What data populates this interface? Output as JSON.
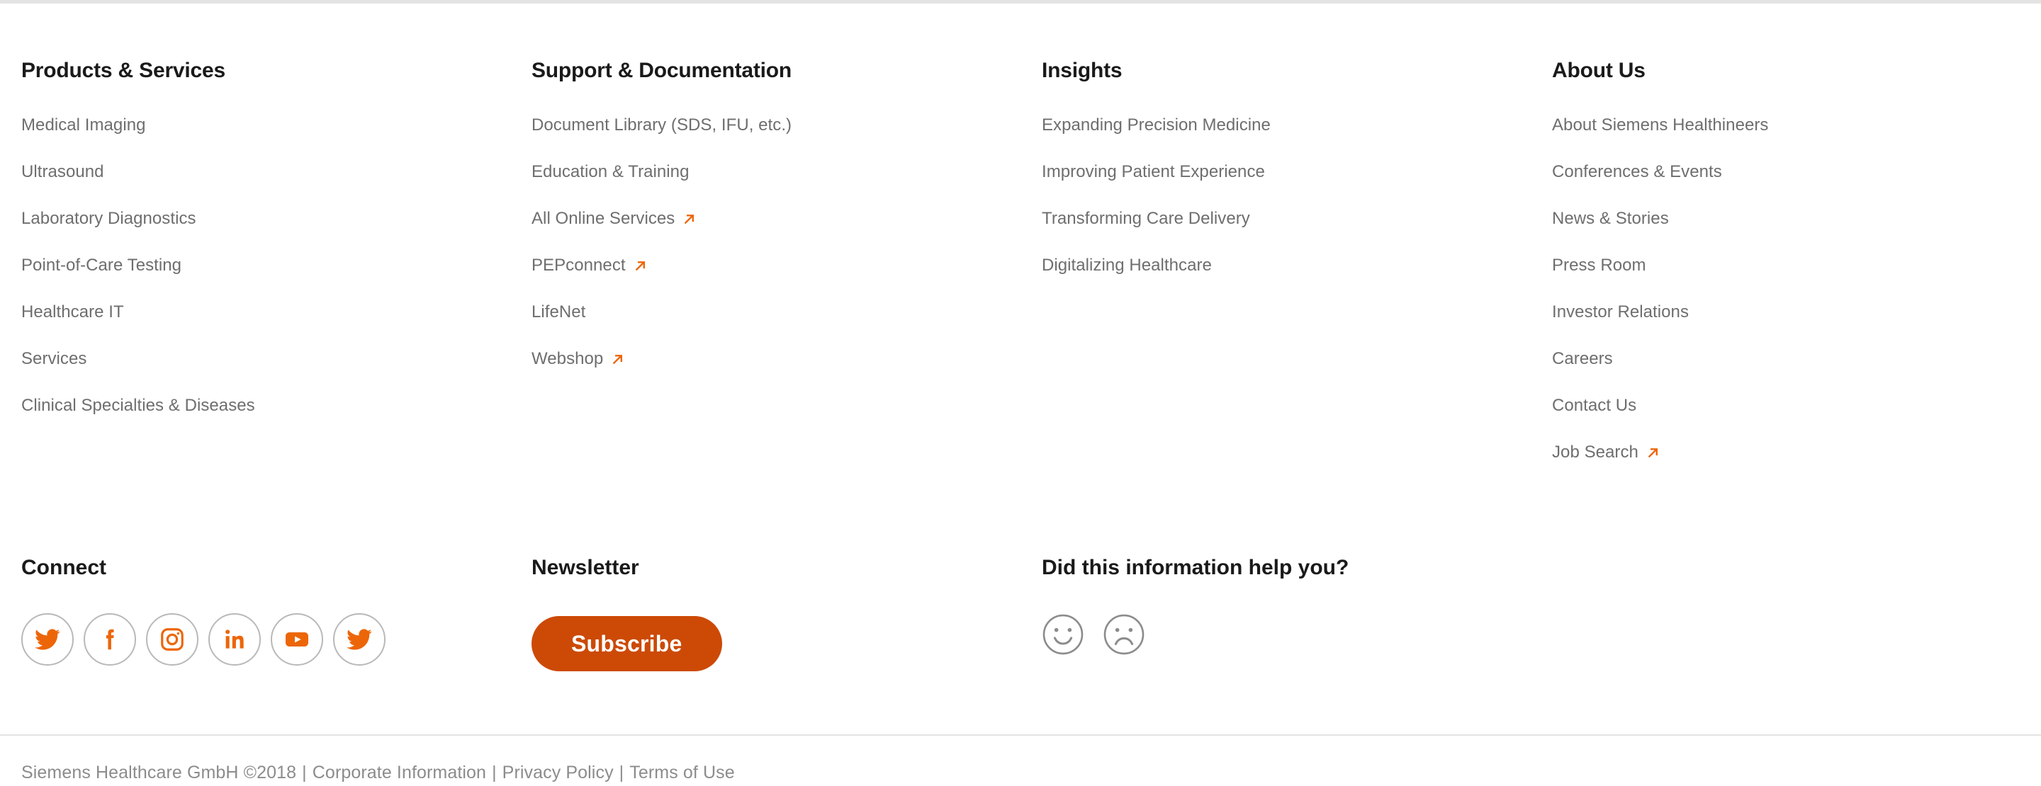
{
  "brand": {
    "accent_orange": "#ec6608",
    "button_orange": "#cc4a06",
    "link_gray": "#6e6e6e",
    "heading_black": "#1a1a1a",
    "divider_gray": "#e3e3e3"
  },
  "columns": [
    {
      "title": "Products & Services",
      "links": [
        {
          "label": "Medical Imaging",
          "external": false
        },
        {
          "label": "Ultrasound",
          "external": false
        },
        {
          "label": "Laboratory Diagnostics",
          "external": false
        },
        {
          "label": "Point-of-Care Testing",
          "external": false
        },
        {
          "label": "Healthcare IT",
          "external": false
        },
        {
          "label": "Services",
          "external": false
        },
        {
          "label": "Clinical Specialties & Diseases",
          "external": false
        }
      ]
    },
    {
      "title": "Support & Documentation",
      "links": [
        {
          "label": "Document Library (SDS, IFU, etc.)",
          "external": false
        },
        {
          "label": "Education & Training",
          "external": false
        },
        {
          "label": "All Online Services",
          "external": true
        },
        {
          "label": "PEPconnect",
          "external": true
        },
        {
          "label": "LifeNet",
          "external": false
        },
        {
          "label": "Webshop",
          "external": true
        }
      ]
    },
    {
      "title": "Insights",
      "links": [
        {
          "label": "Expanding Precision Medicine",
          "external": false
        },
        {
          "label": "Improving Patient Experience",
          "external": false
        },
        {
          "label": "Transforming Care Delivery",
          "external": false
        },
        {
          "label": "Digitalizing Healthcare",
          "external": false
        }
      ]
    },
    {
      "title": "About Us",
      "links": [
        {
          "label": "About Siemens Healthineers",
          "external": false
        },
        {
          "label": "Conferences & Events",
          "external": false
        },
        {
          "label": "News & Stories",
          "external": false
        },
        {
          "label": "Press Room",
          "external": false
        },
        {
          "label": "Investor Relations",
          "external": false
        },
        {
          "label": "Careers",
          "external": false
        },
        {
          "label": "Contact Us",
          "external": false
        },
        {
          "label": "Job Search",
          "external": true
        }
      ]
    }
  ],
  "connect": {
    "title": "Connect",
    "socials": [
      {
        "icon": "twitter-icon",
        "name": "Twitter"
      },
      {
        "icon": "facebook-icon",
        "name": "Facebook"
      },
      {
        "icon": "instagram-icon",
        "name": "Instagram"
      },
      {
        "icon": "linkedin-icon",
        "name": "LinkedIn"
      },
      {
        "icon": "youtube-icon",
        "name": "YouTube"
      },
      {
        "icon": "twitter-icon",
        "name": "Twitter"
      }
    ]
  },
  "newsletter": {
    "title": "Newsletter",
    "subscribe_label": "Subscribe"
  },
  "feedback": {
    "title": "Did this information help you?",
    "positive_icon": "smiley-happy-icon",
    "negative_icon": "smiley-sad-icon"
  },
  "legal": {
    "copyright": "Siemens Healthcare GmbH ©2018",
    "separator": "|",
    "links": [
      "Corporate Information",
      "Privacy Policy",
      "Terms of Use"
    ]
  }
}
